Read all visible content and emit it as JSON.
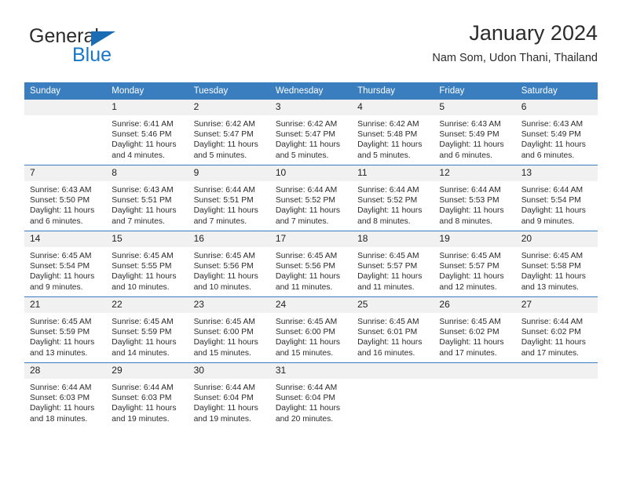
{
  "brand": {
    "word_one": "General",
    "word_two": "Blue",
    "triangle_color": "#1b6cb3",
    "blue_color": "#1878c8"
  },
  "header": {
    "title": "January 2024",
    "subtitle": "Nam Som, Udon Thani, Thailand"
  },
  "theme": {
    "header_bar_color": "#3a7ebf",
    "daynum_band_color": "#f1f1f1",
    "row_divider_color": "#3a7ebf",
    "text_color": "#2b2b2b"
  },
  "calendar": {
    "weekday_headers": [
      "Sunday",
      "Monday",
      "Tuesday",
      "Wednesday",
      "Thursday",
      "Friday",
      "Saturday"
    ],
    "weeks": [
      [
        {
          "day": "",
          "sunrise": "",
          "sunset": "",
          "daylight_line1": "",
          "daylight_line2": ""
        },
        {
          "day": "1",
          "sunrise": "Sunrise: 6:41 AM",
          "sunset": "Sunset: 5:46 PM",
          "daylight_line1": "Daylight: 11 hours",
          "daylight_line2": "and 4 minutes."
        },
        {
          "day": "2",
          "sunrise": "Sunrise: 6:42 AM",
          "sunset": "Sunset: 5:47 PM",
          "daylight_line1": "Daylight: 11 hours",
          "daylight_line2": "and 5 minutes."
        },
        {
          "day": "3",
          "sunrise": "Sunrise: 6:42 AM",
          "sunset": "Sunset: 5:47 PM",
          "daylight_line1": "Daylight: 11 hours",
          "daylight_line2": "and 5 minutes."
        },
        {
          "day": "4",
          "sunrise": "Sunrise: 6:42 AM",
          "sunset": "Sunset: 5:48 PM",
          "daylight_line1": "Daylight: 11 hours",
          "daylight_line2": "and 5 minutes."
        },
        {
          "day": "5",
          "sunrise": "Sunrise: 6:43 AM",
          "sunset": "Sunset: 5:49 PM",
          "daylight_line1": "Daylight: 11 hours",
          "daylight_line2": "and 6 minutes."
        },
        {
          "day": "6",
          "sunrise": "Sunrise: 6:43 AM",
          "sunset": "Sunset: 5:49 PM",
          "daylight_line1": "Daylight: 11 hours",
          "daylight_line2": "and 6 minutes."
        }
      ],
      [
        {
          "day": "7",
          "sunrise": "Sunrise: 6:43 AM",
          "sunset": "Sunset: 5:50 PM",
          "daylight_line1": "Daylight: 11 hours",
          "daylight_line2": "and 6 minutes."
        },
        {
          "day": "8",
          "sunrise": "Sunrise: 6:43 AM",
          "sunset": "Sunset: 5:51 PM",
          "daylight_line1": "Daylight: 11 hours",
          "daylight_line2": "and 7 minutes."
        },
        {
          "day": "9",
          "sunrise": "Sunrise: 6:44 AM",
          "sunset": "Sunset: 5:51 PM",
          "daylight_line1": "Daylight: 11 hours",
          "daylight_line2": "and 7 minutes."
        },
        {
          "day": "10",
          "sunrise": "Sunrise: 6:44 AM",
          "sunset": "Sunset: 5:52 PM",
          "daylight_line1": "Daylight: 11 hours",
          "daylight_line2": "and 7 minutes."
        },
        {
          "day": "11",
          "sunrise": "Sunrise: 6:44 AM",
          "sunset": "Sunset: 5:52 PM",
          "daylight_line1": "Daylight: 11 hours",
          "daylight_line2": "and 8 minutes."
        },
        {
          "day": "12",
          "sunrise": "Sunrise: 6:44 AM",
          "sunset": "Sunset: 5:53 PM",
          "daylight_line1": "Daylight: 11 hours",
          "daylight_line2": "and 8 minutes."
        },
        {
          "day": "13",
          "sunrise": "Sunrise: 6:44 AM",
          "sunset": "Sunset: 5:54 PM",
          "daylight_line1": "Daylight: 11 hours",
          "daylight_line2": "and 9 minutes."
        }
      ],
      [
        {
          "day": "14",
          "sunrise": "Sunrise: 6:45 AM",
          "sunset": "Sunset: 5:54 PM",
          "daylight_line1": "Daylight: 11 hours",
          "daylight_line2": "and 9 minutes."
        },
        {
          "day": "15",
          "sunrise": "Sunrise: 6:45 AM",
          "sunset": "Sunset: 5:55 PM",
          "daylight_line1": "Daylight: 11 hours",
          "daylight_line2": "and 10 minutes."
        },
        {
          "day": "16",
          "sunrise": "Sunrise: 6:45 AM",
          "sunset": "Sunset: 5:56 PM",
          "daylight_line1": "Daylight: 11 hours",
          "daylight_line2": "and 10 minutes."
        },
        {
          "day": "17",
          "sunrise": "Sunrise: 6:45 AM",
          "sunset": "Sunset: 5:56 PM",
          "daylight_line1": "Daylight: 11 hours",
          "daylight_line2": "and 11 minutes."
        },
        {
          "day": "18",
          "sunrise": "Sunrise: 6:45 AM",
          "sunset": "Sunset: 5:57 PM",
          "daylight_line1": "Daylight: 11 hours",
          "daylight_line2": "and 11 minutes."
        },
        {
          "day": "19",
          "sunrise": "Sunrise: 6:45 AM",
          "sunset": "Sunset: 5:57 PM",
          "daylight_line1": "Daylight: 11 hours",
          "daylight_line2": "and 12 minutes."
        },
        {
          "day": "20",
          "sunrise": "Sunrise: 6:45 AM",
          "sunset": "Sunset: 5:58 PM",
          "daylight_line1": "Daylight: 11 hours",
          "daylight_line2": "and 13 minutes."
        }
      ],
      [
        {
          "day": "21",
          "sunrise": "Sunrise: 6:45 AM",
          "sunset": "Sunset: 5:59 PM",
          "daylight_line1": "Daylight: 11 hours",
          "daylight_line2": "and 13 minutes."
        },
        {
          "day": "22",
          "sunrise": "Sunrise: 6:45 AM",
          "sunset": "Sunset: 5:59 PM",
          "daylight_line1": "Daylight: 11 hours",
          "daylight_line2": "and 14 minutes."
        },
        {
          "day": "23",
          "sunrise": "Sunrise: 6:45 AM",
          "sunset": "Sunset: 6:00 PM",
          "daylight_line1": "Daylight: 11 hours",
          "daylight_line2": "and 15 minutes."
        },
        {
          "day": "24",
          "sunrise": "Sunrise: 6:45 AM",
          "sunset": "Sunset: 6:00 PM",
          "daylight_line1": "Daylight: 11 hours",
          "daylight_line2": "and 15 minutes."
        },
        {
          "day": "25",
          "sunrise": "Sunrise: 6:45 AM",
          "sunset": "Sunset: 6:01 PM",
          "daylight_line1": "Daylight: 11 hours",
          "daylight_line2": "and 16 minutes."
        },
        {
          "day": "26",
          "sunrise": "Sunrise: 6:45 AM",
          "sunset": "Sunset: 6:02 PM",
          "daylight_line1": "Daylight: 11 hours",
          "daylight_line2": "and 17 minutes."
        },
        {
          "day": "27",
          "sunrise": "Sunrise: 6:44 AM",
          "sunset": "Sunset: 6:02 PM",
          "daylight_line1": "Daylight: 11 hours",
          "daylight_line2": "and 17 minutes."
        }
      ],
      [
        {
          "day": "28",
          "sunrise": "Sunrise: 6:44 AM",
          "sunset": "Sunset: 6:03 PM",
          "daylight_line1": "Daylight: 11 hours",
          "daylight_line2": "and 18 minutes."
        },
        {
          "day": "29",
          "sunrise": "Sunrise: 6:44 AM",
          "sunset": "Sunset: 6:03 PM",
          "daylight_line1": "Daylight: 11 hours",
          "daylight_line2": "and 19 minutes."
        },
        {
          "day": "30",
          "sunrise": "Sunrise: 6:44 AM",
          "sunset": "Sunset: 6:04 PM",
          "daylight_line1": "Daylight: 11 hours",
          "daylight_line2": "and 19 minutes."
        },
        {
          "day": "31",
          "sunrise": "Sunrise: 6:44 AM",
          "sunset": "Sunset: 6:04 PM",
          "daylight_line1": "Daylight: 11 hours",
          "daylight_line2": "and 20 minutes."
        },
        {
          "day": "",
          "sunrise": "",
          "sunset": "",
          "daylight_line1": "",
          "daylight_line2": ""
        },
        {
          "day": "",
          "sunrise": "",
          "sunset": "",
          "daylight_line1": "",
          "daylight_line2": ""
        },
        {
          "day": "",
          "sunrise": "",
          "sunset": "",
          "daylight_line1": "",
          "daylight_line2": ""
        }
      ]
    ]
  }
}
